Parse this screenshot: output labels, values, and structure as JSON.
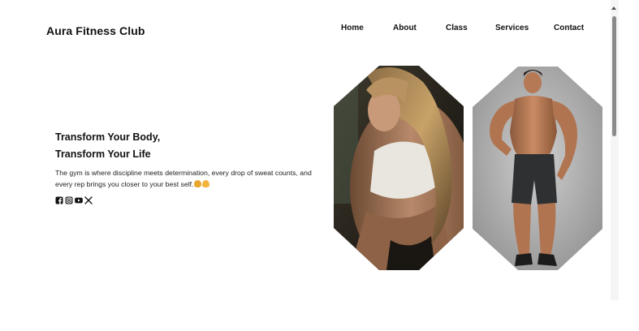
{
  "brand": {
    "name": "Aura Fitness Club"
  },
  "nav": {
    "items": [
      "Home",
      "About",
      "Class",
      "Services",
      "Contact"
    ]
  },
  "hero": {
    "title_line1": "Transform Your Body,",
    "title_line2": "Transform Your Life",
    "description": "The gym is where discipline meets determination, every drop of sweat counts, and every rep brings you closer to your best self."
  },
  "social": {
    "icons": [
      "facebook-icon",
      "instagram-icon",
      "youtube-icon",
      "x-icon"
    ]
  },
  "colors": {
    "background": "#ffffff",
    "text": "#111111"
  }
}
